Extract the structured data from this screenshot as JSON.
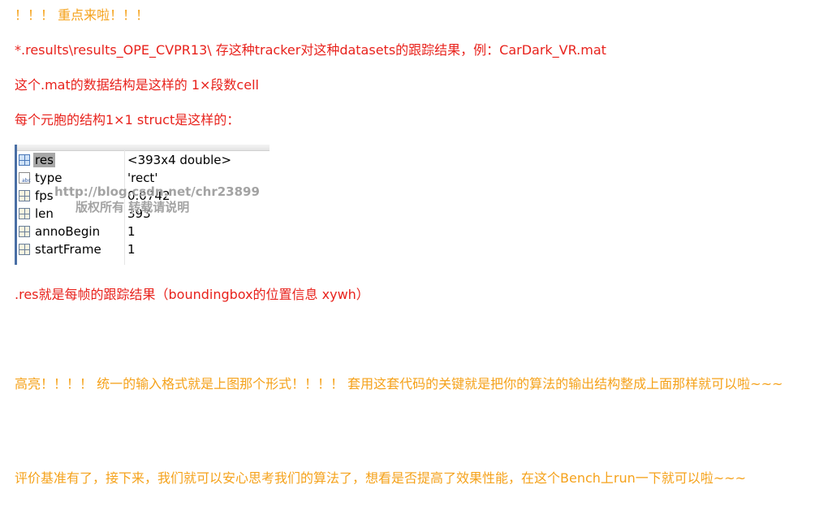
{
  "lines": {
    "l1": "！！！ 重点来啦！！！",
    "l2": "*.results\\results_OPE_CVPR13\\ 存这种tracker对这种datasets的跟踪结果，例：CarDark_VR.mat",
    "l3": "这个.mat的数据结构是这样的  1×段数cell",
    "l4": "每个元胞的结构1×1 struct是这样的：",
    "l5": ".res就是每帧的跟踪结果（boundingbox的位置信息 xywh）",
    "l6": "高亮！！！！ 统一的输入格式就是上图那个形式！！！！ 套用这套代码的关键就是把你的算法的输出结构整成上面那样就可以啦~~~",
    "l7": "评价基准有了，接下来，我们就可以安心思考我们的算法了，想看是否提高了效果性能，在这个Bench上run一下就可以啦~~~"
  },
  "workspace": {
    "rows": [
      {
        "name": "res",
        "value": "<393x4 double>",
        "icon": "matrix-icon"
      },
      {
        "name": "type",
        "value": "'rect'",
        "icon": "char-abc-icon"
      },
      {
        "name": "fps",
        "value": "0.0742",
        "icon": "matrix-icon"
      },
      {
        "name": "len",
        "value": "393",
        "icon": "matrix-icon"
      },
      {
        "name": "annoBegin",
        "value": "1",
        "icon": "matrix-icon"
      },
      {
        "name": "startFrame",
        "value": "1",
        "icon": "matrix-icon"
      }
    ],
    "abc_label": "abc",
    "watermark_line1": "http://blog.csdn.net/chr23899",
    "watermark_line2": "版权所有 转载请说明"
  },
  "colors": {
    "orange": "#f5a21b",
    "red": "#e8221c"
  }
}
